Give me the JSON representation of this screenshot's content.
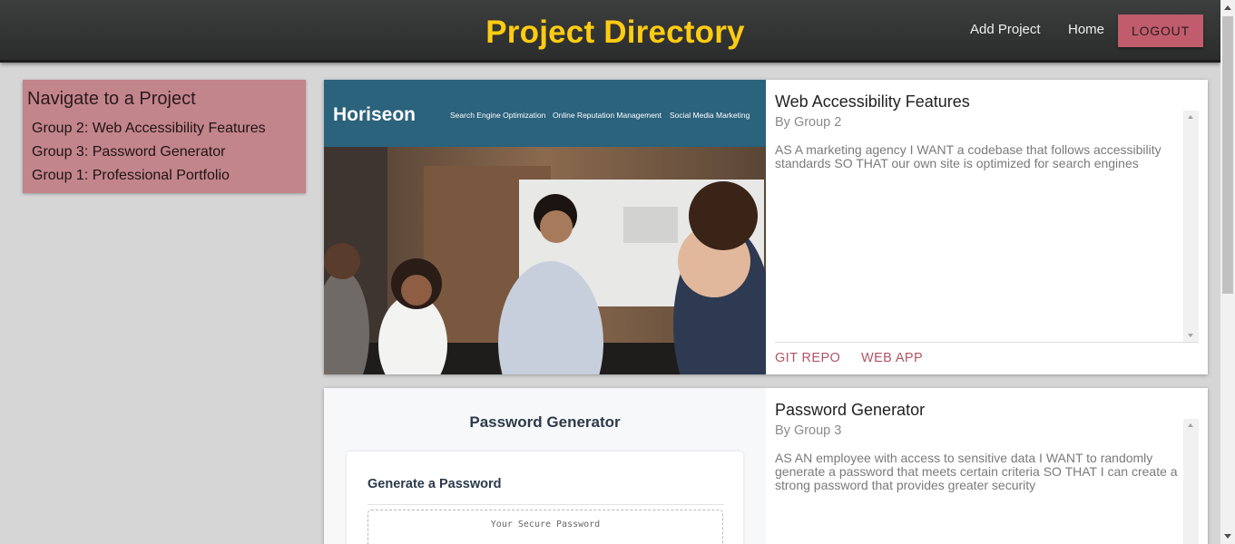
{
  "header": {
    "title": "Project Directory",
    "nav": {
      "add_project": "Add Project",
      "home": "Home",
      "logout": "LOGOUT"
    }
  },
  "sidebar": {
    "heading": "Navigate to a Project",
    "items": [
      {
        "label": "Group 2: Web Accessibility Features"
      },
      {
        "label": "Group 3: Password Generator"
      },
      {
        "label": "Group 1: Professional Portfolio"
      }
    ]
  },
  "projects": [
    {
      "title": "Web Accessibility Features",
      "author": "By Group 2",
      "description": "AS A marketing agency I WANT a codebase that follows accessibility standards SO THAT our own site is optimized for search engines",
      "links": {
        "git": "GIT REPO",
        "web": "WEB APP"
      },
      "preview": {
        "brand": "Horiseon",
        "nav": [
          "Search Engine Optimization",
          "Online Reputation Management",
          "Social Media Marketing"
        ]
      }
    },
    {
      "title": "Password Generator",
      "author": "By Group 3",
      "description": "AS AN employee with access to sensitive data I WANT to randomly generate a password that meets certain criteria SO THAT I can create a strong password that provides greater security",
      "preview": {
        "heading": "Password Generator",
        "panel_title": "Generate a Password",
        "placeholder": "Your Secure Password"
      }
    }
  ],
  "colors": {
    "header_bg": "#2f3030",
    "title": "#ffcc11",
    "accent": "#c05c6c",
    "sidebar_bg": "#c2858b",
    "page_bg": "#d6d6d6",
    "horiseon_bar": "#2b627c"
  }
}
